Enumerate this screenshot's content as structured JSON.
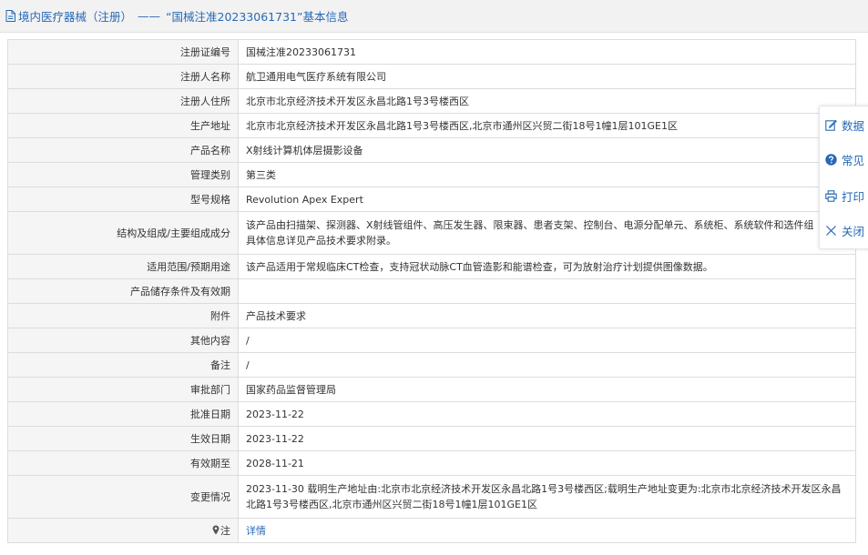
{
  "header": {
    "section": "境内医疗器械（注册）",
    "separator": "——",
    "title": "“国械注准20233061731”基本信息"
  },
  "rows": [
    {
      "label": "注册证编号",
      "value": "国械注准20233061731"
    },
    {
      "label": "注册人名称",
      "value": "航卫通用电气医疗系统有限公司"
    },
    {
      "label": "注册人住所",
      "value": "北京市北京经济技术开发区永昌北路1号3号楼西区"
    },
    {
      "label": "生产地址",
      "value": "北京市北京经济技术开发区永昌北路1号3号楼西区,北京市通州区兴贸二街18号1幢1层101GE1区"
    },
    {
      "label": "产品名称",
      "value": "X射线计算机体层摄影设备"
    },
    {
      "label": "管理类别",
      "value": "第三类"
    },
    {
      "label": "型号规格",
      "value": "Revolution Apex Expert"
    },
    {
      "label": "结构及组成/主要组成成分",
      "value_line1": "该产品由扫描架、探测器、X射线管组件、高压发生器、限束器、患者支架、控制台、电源分配单元、系统柜、系统软件和选件组",
      "value_line2": "具体信息详见产品技术要求附录。"
    },
    {
      "label": "适用范围/预期用途",
      "value": "该产品适用于常规临床CT检查，支持冠状动脉CT血管造影和能谱检查，可为放射治疗计划提供图像数据。"
    },
    {
      "label": "产品储存条件及有效期",
      "value": ""
    },
    {
      "label": "附件",
      "value": "产品技术要求"
    },
    {
      "label": "其他内容",
      "value": "/"
    },
    {
      "label": "备注",
      "value": "/"
    },
    {
      "label": "审批部门",
      "value": "国家药品监督管理局"
    },
    {
      "label": "批准日期",
      "value": "2023-11-22"
    },
    {
      "label": "生效日期",
      "value": "2023-11-22"
    },
    {
      "label": "有效期至",
      "value": "2028-11-21"
    },
    {
      "label": "变更情况",
      "value_line1": "2023-11-30 载明生产地址由:北京市北京经济技术开发区永昌北路1号3号楼西区;载明生产地址变更为:北京市北京经济技术开发区永昌",
      "value_line2": "北路1号3号楼西区,北京市通州区兴贸二街18号1幢1层101GE1区"
    },
    {
      "label": "注",
      "value": "详情"
    }
  ],
  "side_panel": {
    "items": [
      {
        "label": "数据",
        "icon": "edit-icon"
      },
      {
        "label": "常见",
        "icon": "question-circle-icon"
      },
      {
        "label": "打印",
        "icon": "print-icon"
      },
      {
        "label": "关闭",
        "icon": "close-icon"
      }
    ]
  },
  "colors": {
    "link": "#2769b6",
    "header_bg": "#f2f2f2",
    "label_bg": "#f5f5f5",
    "border": "#dcdcdc"
  }
}
